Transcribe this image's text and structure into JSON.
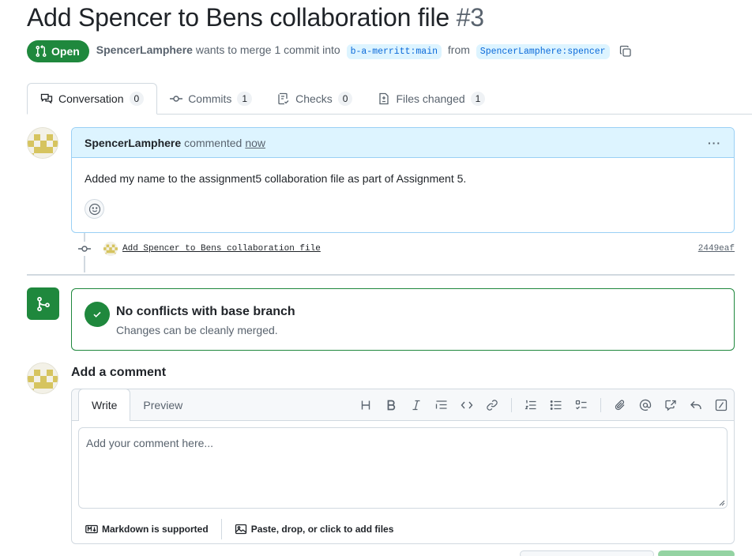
{
  "pr": {
    "title": "Add Spencer to Bens collaboration file",
    "number": "#3",
    "state": "Open",
    "author": "SpencerLamphere",
    "action_text": "wants to merge 1 commit into",
    "base_branch": "b-a-merritt:main",
    "from_text": "from",
    "head_branch": "SpencerLamphere:spencer"
  },
  "tabs": [
    {
      "label": "Conversation",
      "count": "0",
      "icon": "comment-discussion-icon"
    },
    {
      "label": "Commits",
      "count": "1",
      "icon": "git-commit-icon"
    },
    {
      "label": "Checks",
      "count": "0",
      "icon": "checklist-icon"
    },
    {
      "label": "Files changed",
      "count": "1",
      "icon": "file-diff-icon"
    }
  ],
  "comment": {
    "author": "SpencerLamphere",
    "verb": "commented",
    "time": "now",
    "more": "···",
    "body": "Added my name to the assignment5 collaboration file as part of Assignment 5."
  },
  "commit": {
    "message": "Add Spencer to Bens collaboration file",
    "sha": "2449eaf"
  },
  "merge": {
    "title": "No conflicts with base branch",
    "subtitle": "Changes can be cleanly merged."
  },
  "new_comment": {
    "heading": "Add a comment",
    "tab_write": "Write",
    "tab_preview": "Preview",
    "placeholder": "Add your comment here...",
    "markdown_note": "Markdown is supported",
    "attach_note": "Paste, drop, or click to add files"
  },
  "colors": {
    "green": "#1f883d",
    "blue_link": "#0969da",
    "comment_header": "#ddf4ff",
    "avatar_pattern": "#d6c45f"
  }
}
